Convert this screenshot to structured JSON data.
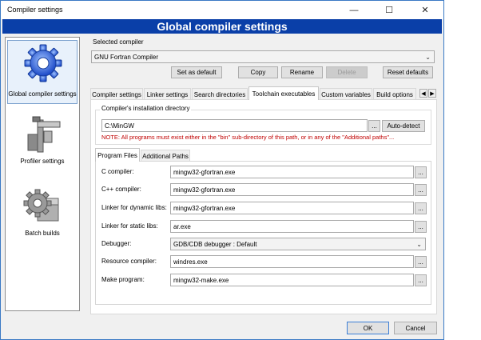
{
  "window": {
    "title": "Compiler settings",
    "minimize_icon": "minimize-icon",
    "maximize_icon": "maximize-icon",
    "close_icon": "close-icon"
  },
  "banner": {
    "title": "Global compiler settings"
  },
  "sidebar": {
    "items": [
      {
        "label": "Global compiler settings",
        "icon": "gear-icon",
        "selected": true
      },
      {
        "label": "Profiler settings",
        "icon": "caliper-icon",
        "selected": false
      },
      {
        "label": "Batch builds",
        "icon": "batch-gear-icon",
        "selected": false
      }
    ]
  },
  "selected_compiler": {
    "label": "Selected compiler",
    "value": "GNU Fortran Compiler"
  },
  "compiler_buttons": {
    "set_default": "Set as default",
    "copy": "Copy",
    "rename": "Rename",
    "delete": "Delete",
    "reset": "Reset defaults"
  },
  "tabs": [
    {
      "label": "Compiler settings",
      "active": false
    },
    {
      "label": "Linker settings",
      "active": false
    },
    {
      "label": "Search directories",
      "active": false
    },
    {
      "label": "Toolchain executables",
      "active": true
    },
    {
      "label": "Custom variables",
      "active": false
    },
    {
      "label": "Build options",
      "active": false
    }
  ],
  "install_dir": {
    "group_label": "Compiler's installation directory",
    "value": "C:\\MinGW",
    "browse": "...",
    "auto_detect": "Auto-detect",
    "note": "NOTE: All programs must exist either in the \"bin\" sub-directory of this path, or in any of the \"Additional paths\"..."
  },
  "subtabs": [
    {
      "label": "Program Files",
      "active": true
    },
    {
      "label": "Additional Paths",
      "active": false
    }
  ],
  "programs": [
    {
      "label": "C compiler:",
      "value": "mingw32-gfortran.exe",
      "type": "text"
    },
    {
      "label": "C++ compiler:",
      "value": "mingw32-gfortran.exe",
      "type": "text"
    },
    {
      "label": "Linker for dynamic libs:",
      "value": "mingw32-gfortran.exe",
      "type": "text"
    },
    {
      "label": "Linker for static libs:",
      "value": "ar.exe",
      "type": "text"
    },
    {
      "label": "Debugger:",
      "value": "GDB/CDB debugger : Default",
      "type": "select"
    },
    {
      "label": "Resource compiler:",
      "value": "windres.exe",
      "type": "text"
    },
    {
      "label": "Make program:",
      "value": "mingw32-make.exe",
      "type": "text"
    }
  ],
  "dialog_buttons": {
    "ok": "OK",
    "cancel": "Cancel"
  },
  "colors": {
    "banner": "#0a3fa8",
    "note": "#c00000"
  }
}
